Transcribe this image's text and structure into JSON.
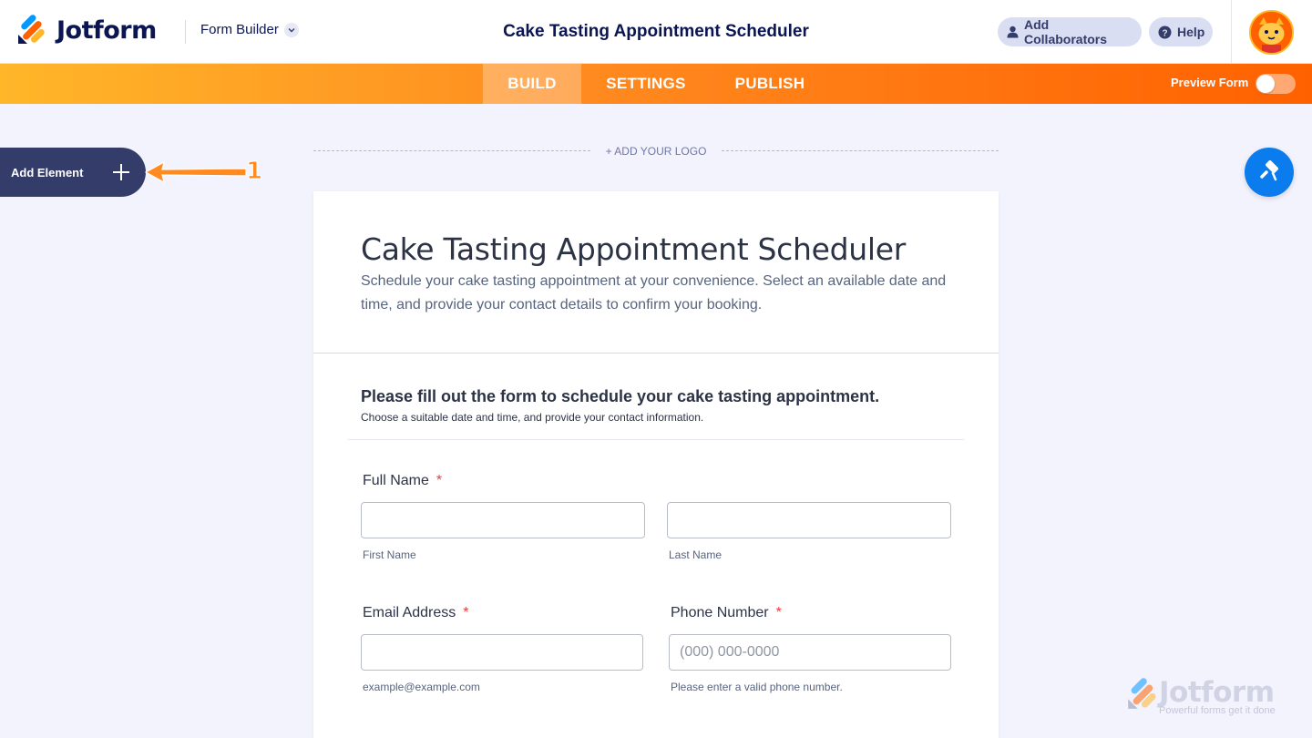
{
  "header": {
    "brand": "Jotform",
    "mode_label": "Form Builder",
    "title": "Cake Tasting Appointment Scheduler",
    "add_collaborators_label": "Add Collaborators",
    "help_label": "Help"
  },
  "nav": {
    "tabs": [
      {
        "label": "BUILD",
        "active": true
      },
      {
        "label": "SETTINGS",
        "active": false
      },
      {
        "label": "PUBLISH",
        "active": false
      }
    ],
    "preview_label": "Preview Form",
    "preview_on": false
  },
  "sidebar": {
    "add_element_label": "Add Element",
    "step_number": "1"
  },
  "canvas": {
    "add_logo_label": "+ ADD YOUR LOGO"
  },
  "form": {
    "title": "Cake Tasting Appointment Scheduler",
    "description": "Schedule your cake tasting appointment at your convenience. Select an available date and time, and provide your contact details to confirm your booking.",
    "section_title": "Please fill out the form to schedule your cake tasting appointment.",
    "section_subtitle": "Choose a suitable date and time, and provide your contact information.",
    "fields": {
      "full_name": {
        "label": "Full Name",
        "required_mark": "*",
        "first_hint": "First Name",
        "last_hint": "Last Name",
        "first_value": "",
        "last_value": ""
      },
      "email": {
        "label": "Email Address",
        "required_mark": "*",
        "hint": "example@example.com",
        "value": ""
      },
      "phone": {
        "label": "Phone Number",
        "required_mark": "*",
        "placeholder": "(000) 000-0000",
        "hint": "Please enter a valid phone number.",
        "value": ""
      }
    }
  },
  "watermark": {
    "brand": "Jotform",
    "tagline": "Powerful forms get it done"
  },
  "colors": {
    "brand_navy": "#0a1551",
    "orange_start": "#ffb629",
    "orange_end": "#ff6100",
    "designer_blue": "#0a7cee",
    "required_red": "#f23a3c"
  },
  "icons": [
    "jotform-logo-icon",
    "chevron-down-icon",
    "user-icon",
    "question-icon",
    "plus-icon",
    "paint-roller-icon",
    "avatar-icon",
    "arrow-annotation-icon"
  ]
}
